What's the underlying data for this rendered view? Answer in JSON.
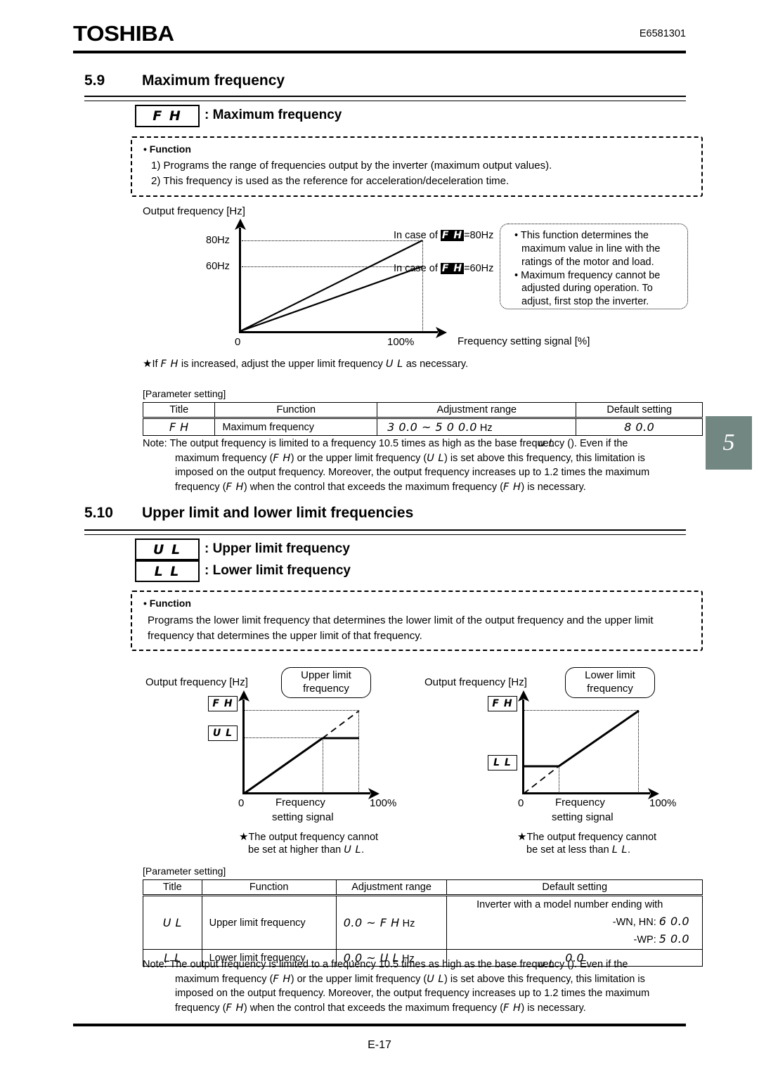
{
  "header": {
    "brand": "TOSHIBA",
    "doc_code": "E6581301"
  },
  "chapter_tab": {
    "label": "5",
    "color": "#728782"
  },
  "footer": {
    "page": "E-17"
  },
  "sections": {
    "s59": {
      "number": "5.9",
      "title": "Maximum frequency",
      "param_box": {
        "code": "F H",
        "label": ": Maximum frequency"
      },
      "function": {
        "heading": "• Function",
        "lines": [
          "1) Programs the range of frequencies output by the inverter (maximum output values).",
          "2) This frequency is used as the reference for acceleration/deceleration time."
        ]
      },
      "graph": {
        "y_axis_title": "Output frequency [Hz]",
        "y_ticks": [
          "80Hz",
          "60Hz"
        ],
        "x_origin": "0",
        "x_max": "100%",
        "x_axis_title": "Frequency setting signal [%]",
        "series_labels": [
          {
            "prefix": "In case of ",
            "code": "F H",
            "suffix": "=80Hz"
          },
          {
            "prefix": "In case of ",
            "code": "F H",
            "suffix": "=60Hz"
          }
        ]
      },
      "side_note": [
        "This function determines the maximum value in line with the ratings of the motor and load.",
        "Maximum frequency cannot be adjusted during operation. To adjust, first stop the inverter."
      ],
      "star_note": {
        "star": "★",
        "pre": "If ",
        "code1": "F H",
        "mid": " is increased, adjust the upper limit frequency ",
        "code2": "U L",
        "post": " as necessary."
      },
      "table": {
        "caption": "[Parameter setting]",
        "headers": [
          "Title",
          "Function",
          "Adjustment range",
          "Default setting"
        ],
        "rows": [
          {
            "title": "F H",
            "function": "Maximum frequency",
            "range_code": "3 0.0 ~ 5 0 0.0",
            "range_unit": " Hz",
            "default": "8 0.0"
          }
        ]
      },
      "note": {
        "label": "Note:",
        "l1_a": " The output frequency is limited to a frequency 10.5 times as high as the base frequency (",
        "l1_code": "u L",
        "l1_b": "). Even if the",
        "l2_a": "maximum frequency (",
        "l2_code1": "F H",
        "l2_b": ") or the upper limit frequency (",
        "l2_code2": "U L",
        "l2_c": ") is set above this frequency, this limitation is",
        "l3": "imposed on the output frequency.  Moreover, the output frequency increases up to 1.2 times the maximum",
        "l4_a": "frequency (",
        "l4_code1": "F H",
        "l4_b": ") when the control that exceeds the maximum frequency (",
        "l4_code2": "F H",
        "l4_c": ") is necessary."
      }
    },
    "s510": {
      "number": "5.10",
      "title": "Upper limit and lower limit frequencies",
      "param_boxes": [
        {
          "code": "U L",
          "label": ": Upper limit frequency"
        },
        {
          "code": "L L",
          "label": ": Lower limit frequency"
        }
      ],
      "function": {
        "heading": "• Function",
        "lines": [
          "Programs the lower limit frequency that determines the lower limit of the output frequency and the upper limit",
          "frequency that determines the upper limit of that frequency."
        ]
      },
      "graph_left": {
        "y_axis_title": "Output frequency [Hz]",
        "callout": "Upper limit frequency",
        "y_label_top": "F H",
        "y_label_mid": "U L",
        "x_origin": "0",
        "x_title_l1": "Frequency",
        "x_title_l2": "setting signal",
        "x_max": "100%",
        "star": "★",
        "star_l1": "The output frequency cannot",
        "star_l2_a": "be set at higher than ",
        "star_l2_code": "U L",
        "star_l2_b": "."
      },
      "graph_right": {
        "y_axis_title": "Output frequency [Hz]",
        "callout": "Lower limit frequency",
        "y_label_top": "F H",
        "y_label_mid": "L L",
        "x_origin": "0",
        "x_title_l1": "Frequency",
        "x_title_l2": "setting signal",
        "x_max": "100%",
        "star": "★",
        "star_l1": "The output frequency cannot",
        "star_l2_a": "be set at less than ",
        "star_l2_code": "L L",
        "star_l2_b": "."
      },
      "table": {
        "caption": "[Parameter setting]",
        "headers": [
          "Title",
          "Function",
          "Adjustment range",
          "Default setting"
        ],
        "rows": [
          {
            "title": "U L",
            "function": "Upper limit frequency",
            "range_code": "0.0 ~ F H",
            "range_unit": " Hz",
            "default_intro": "Inverter with a model number ending with",
            "default_l1_label": "-WN, HN: ",
            "default_l1_value": "6 0.0",
            "default_l2_label": "-WP: ",
            "default_l2_value": "5 0.0"
          },
          {
            "title": "L L",
            "function": "Lower limit frequency",
            "range_code": "0.0 ~ U L",
            "range_unit": " Hz",
            "default": "0.0"
          }
        ]
      },
      "note": {
        "label": "Note:",
        "l1_a": " The output frequency is limited to a frequency 10.5 times as high as the base frequency (",
        "l1_code": "u L",
        "l1_b": "). Even if the",
        "l2_a": "maximum frequency (",
        "l2_code1": "F H",
        "l2_b": ") or the upper limit frequency (",
        "l2_code2": "U L",
        "l2_c": ") is set above this frequency, this limitation is",
        "l3": "imposed on the output frequency.  Moreover, the output frequency increases up to 1.2 times the maximum",
        "l4_a": "frequency (",
        "l4_code1": "F H",
        "l4_b": ") when the control that exceeds the maximum frequency (",
        "l4_code2": "F H",
        "l4_c": ") is necessary."
      }
    }
  }
}
